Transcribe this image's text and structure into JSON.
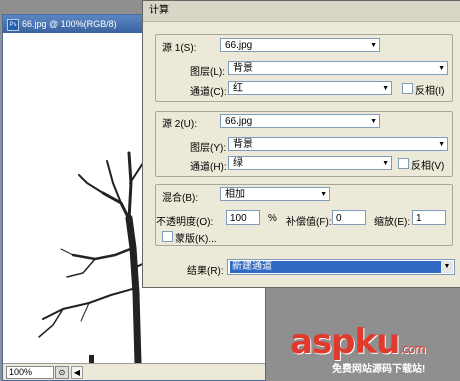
{
  "document": {
    "title": "66.jpg @ 100%(RGB/8)",
    "app_badge": "Ps",
    "zoom": "100%"
  },
  "dialog": {
    "title": "计算",
    "source1": {
      "label": "源 1(S):",
      "file": "66.jpg",
      "layer_label": "图层(L):",
      "layer": "背景",
      "channel_label": "通道(C):",
      "channel": "红",
      "invert_label": "反相(I)",
      "invert": false
    },
    "source2": {
      "label": "源 2(U):",
      "file": "66.jpg",
      "layer_label": "图层(Y):",
      "layer": "背景",
      "channel_label": "通道(H):",
      "channel": "绿",
      "invert_label": "反相(V)",
      "invert": false
    },
    "blending": {
      "label": "混合(B):",
      "mode": "相加",
      "opacity_label": "不透明度(O):",
      "opacity": "100",
      "opacity_unit": "%",
      "offset_label": "补偿值(F):",
      "offset": "0",
      "scale_label": "缩放(E):",
      "scale": "1",
      "mask_label": "蒙版(K)...",
      "mask": false
    },
    "result": {
      "label": "结果(R):",
      "value": "新建通道"
    }
  },
  "watermark": {
    "logo": "aspku",
    "suffix": ".com",
    "subtitle": "免费网站源码下载站!"
  }
}
